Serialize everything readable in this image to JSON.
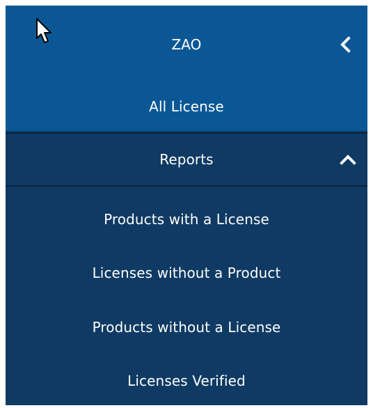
{
  "menu": {
    "title": "ZAO",
    "all_license": "All License",
    "reports": {
      "label": "Reports",
      "expanded": true,
      "items": [
        {
          "label": "Products with a License"
        },
        {
          "label": "Licenses without a Product"
        },
        {
          "label": "Products without a License"
        },
        {
          "label": "Licenses Verified"
        }
      ]
    },
    "icons": {
      "collapse": "chevron-left-icon",
      "reports_toggle": "chevron-up-icon",
      "pointer": "mouse-cursor-icon"
    }
  },
  "colors": {
    "header_bg": "#0b5796",
    "menu_bg": "#0f3a63",
    "divider": "#07233f",
    "text": "#ffffff"
  }
}
